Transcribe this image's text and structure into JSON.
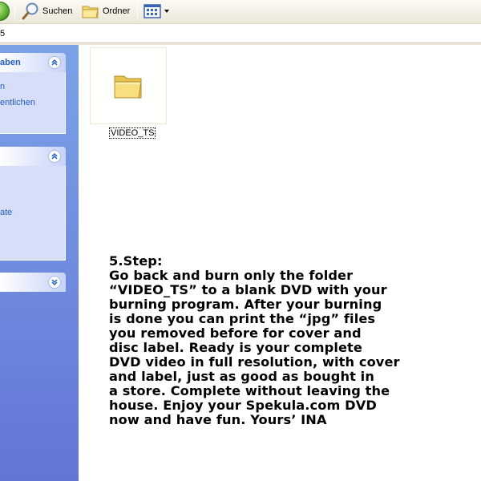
{
  "toolbar": {
    "back_icon": "back-arrow-icon",
    "search_label": "Suchen",
    "folders_label": "Ordner",
    "views_icon": "views-icon"
  },
  "address": {
    "text": "5"
  },
  "taskpane": {
    "panels": [
      {
        "title": "aben",
        "links": [
          "n",
          "entlichen"
        ],
        "expanded": true
      },
      {
        "title": "",
        "links": [
          "ate"
        ],
        "expanded": true
      },
      {
        "title": "",
        "links": [],
        "expanded": false
      }
    ]
  },
  "content": {
    "items": [
      {
        "name": "VIDEO_TS",
        "icon": "folder-icon"
      }
    ],
    "instructions": [
      "5.Step:",
      "Go back and burn only the folder",
      "“VIDEO_TS” to a blank DVD with your",
      "burning program. After your burning",
      "is done you can print the “jpg” files",
      "you removed before for cover and",
      "disc label. Ready is your complete",
      "DVD video in full resolution, with cover",
      "and label, just as good as bought in",
      "a store. Complete without leaving the",
      "house. Enjoy your Spekula.com DVD",
      "now and have fun. Yours’ INA"
    ]
  },
  "colors": {
    "taskpane_top": "#7ba2e7",
    "taskpane_bottom": "#6375d6",
    "link": "#215dc6",
    "panel_body": "#d6dff7"
  }
}
